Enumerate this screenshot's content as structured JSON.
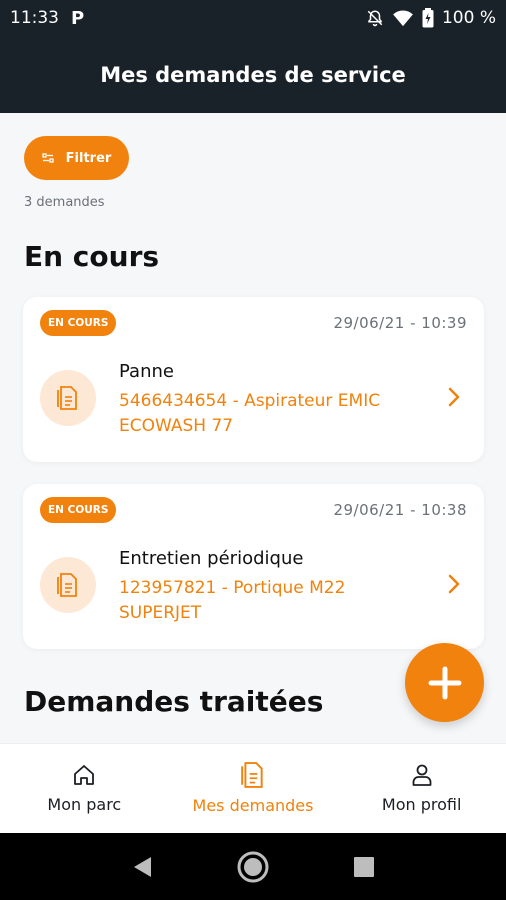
{
  "status_bar": {
    "time": "11:33",
    "notification_icon": "P",
    "battery": "100 %",
    "icons": [
      "bell-off-icon",
      "wifi-icon",
      "battery-icon"
    ]
  },
  "header": {
    "title": "Mes demandes de service"
  },
  "filter": {
    "label": "Filtrer"
  },
  "requests_count": "3 demandes",
  "sections": {
    "in_progress": "En cours",
    "processed": "Demandes traitées"
  },
  "cards": [
    {
      "badge": "EN COURS",
      "date": "29/06/21 - 10:39",
      "title": "Panne",
      "subtitle": "5466434654 - Aspirateur EMIC ECOWASH 77"
    },
    {
      "badge": "EN COURS",
      "date": "29/06/21 - 10:38",
      "title": "Entretien périodique",
      "subtitle": "123957821 - Portique M22 SUPERJET"
    }
  ],
  "bottom_nav": {
    "items": [
      {
        "label": "Mon parc",
        "icon": "home-icon",
        "active": false
      },
      {
        "label": "Mes demandes",
        "icon": "document-icon",
        "active": true
      },
      {
        "label": "Mon profil",
        "icon": "user-icon",
        "active": false
      }
    ]
  },
  "colors": {
    "accent": "#f0820d",
    "header_bg": "#1a2229",
    "accent_light": "#fde8d6"
  }
}
